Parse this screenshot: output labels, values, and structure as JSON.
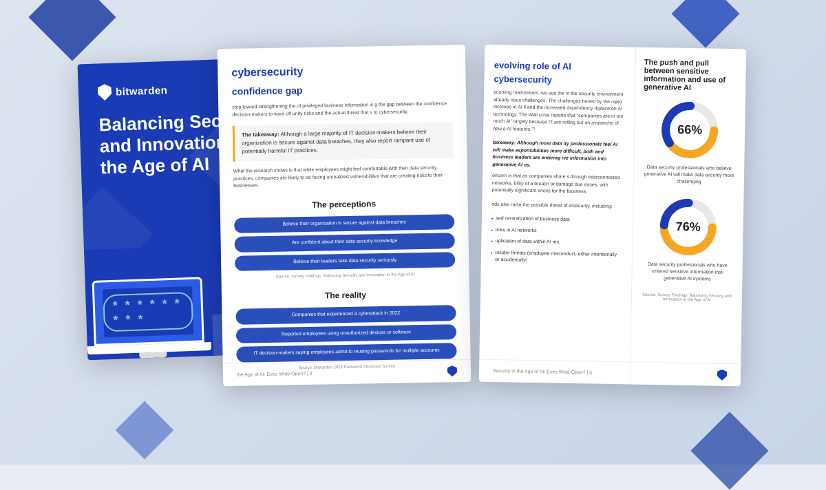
{
  "scene": {
    "background": "#dde4f0"
  },
  "cover": {
    "logo_text": "bit",
    "logo_bold": "warden",
    "title": "Balancing Security and Innovation in the Age of AI",
    "password_dots": "* * * * * * * * *"
  },
  "page2": {
    "header": "cybersecurity",
    "subheader": "confidence gap",
    "body_text_1": "step toward strengthening the of privileged business information is g the gap between the confidence decision-makers to ward off unity risks and the actual threat that s to cybersecurity.",
    "takeaway_label": "The takeaway:",
    "takeaway_text": "Although a large majority of IT decision-makers believe their organization is secure against data breaches, they also report rampant use of potentially harmful IT practices.",
    "takeaway_sub": "What the research shows is that while employees might feel comfortable with their data security practices, companies are likely to be facing unrealized vulnerabilities that are creating risks to their businesses.",
    "perceptions_title": "The perceptions",
    "bars_perceptions": [
      "Believe their organization is secure against data breaches",
      "Are confident about their data security knowledge",
      "Believe their leaders take data security seriously"
    ],
    "source_perceptions": "Source: Survey Findings: Balancing Security and Innovation in the Age of AI",
    "reality_title": "The reality",
    "bars_reality": [
      "Companies that experienced a cyberattack in 2022",
      "Reported employees using unauthorized devices or software",
      "IT decision-makers saying employees admit to reusing passwords for multiple accounts"
    ],
    "source_reality": "Source: Bitwarden 2023 Password Decisions Survey",
    "footer_text": "the Age of AI: Eyes Wide Open?  |  3"
  },
  "page3": {
    "left": {
      "section_title": "evolving role of AI",
      "section_subtitle": "cybersecurity",
      "body_1": "ecoming mainstream, we see the in the security environment already rious challenges. The challenges hened by the rapid increase in AI ll and the increased dependency rkplace on AI technology. The Wall urnal reports that \"companies are in too much AI\" largely because IT are rolling out an avalanche of new e AI features.\"³",
      "italic_takeaway": "takeaway: Although most data ity professionals feel AI will make esponsibilities more difficult, both and business leaders are entering ive information into generative AI ns.",
      "concern_text": "oncern is that as companies share s through interconnected networks, bility of a breach or damage due eases, with potentially significant ences for the business.",
      "also_text": "nds also raise the possible threat of ersecurity, including:",
      "bullets": [
        "sed centralization of business data",
        "links in AI networks",
        "uplication of data within AI ms.",
        "Insider threats (employee misconduct, either intentionally or accidentally)"
      ]
    },
    "right": {
      "section_title": "The push and pull between sensitive information and use of generative AI",
      "donut1": {
        "pct": "66%",
        "pct_num": 66,
        "desc": "Data security professionals who believe generative AI will make data security more challenging"
      },
      "donut2": {
        "pct": "76%",
        "pct_num": 76,
        "desc": "Data security professionals who have entered sensitive information into generative AI systems"
      },
      "source_text": "Source: Survey Findings: Balancing Security and Innovation in the Age of AI"
    },
    "footer_text": "Security in the Age of AI: Eyes Wide Open?  |  4"
  }
}
